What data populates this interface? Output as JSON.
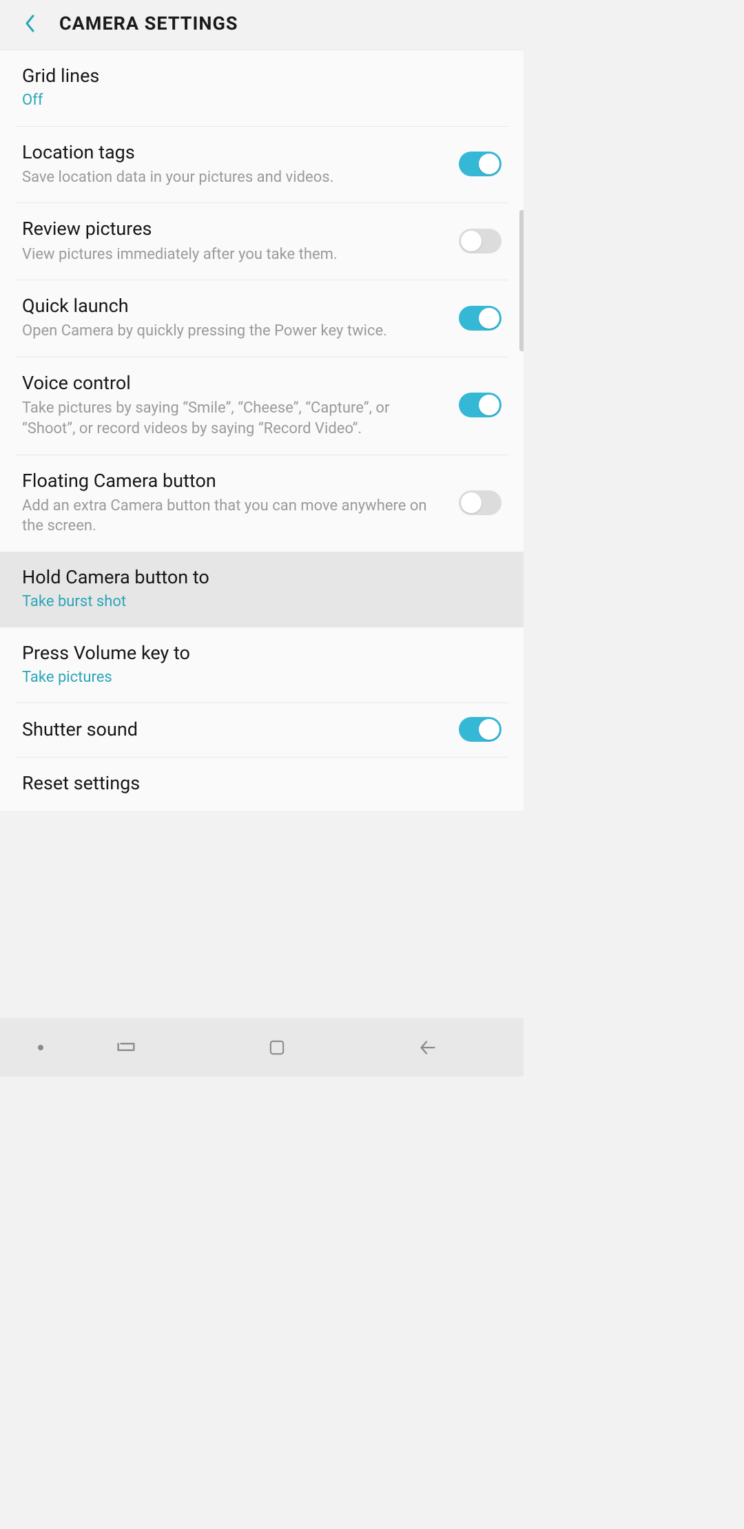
{
  "header": {
    "title": "CAMERA SETTINGS"
  },
  "items": {
    "grid_lines": {
      "title": "Grid lines",
      "value": "Off"
    },
    "location_tags": {
      "title": "Location tags",
      "sub": "Save location data in your pictures and videos."
    },
    "review_pictures": {
      "title": "Review pictures",
      "sub": "View pictures immediately after you take them."
    },
    "quick_launch": {
      "title": "Quick launch",
      "sub": "Open Camera by quickly pressing the Power key twice."
    },
    "voice_control": {
      "title": "Voice control",
      "sub": "Take pictures by saying “Smile”, “Cheese”, “Capture”, or “Shoot”, or record videos by saying “Record Video”."
    },
    "floating_button": {
      "title": "Floating Camera button",
      "sub": "Add an extra Camera button that you can move anywhere on the screen."
    },
    "hold_camera": {
      "title": "Hold Camera button to",
      "value": "Take burst shot"
    },
    "press_volume": {
      "title": "Press Volume key to",
      "value": "Take pictures"
    },
    "shutter_sound": {
      "title": "Shutter sound"
    },
    "reset": {
      "title": "Reset settings"
    }
  },
  "toggles": {
    "location_tags": true,
    "review_pictures": false,
    "quick_launch": true,
    "voice_control": true,
    "floating_button": false,
    "shutter_sound": true
  }
}
